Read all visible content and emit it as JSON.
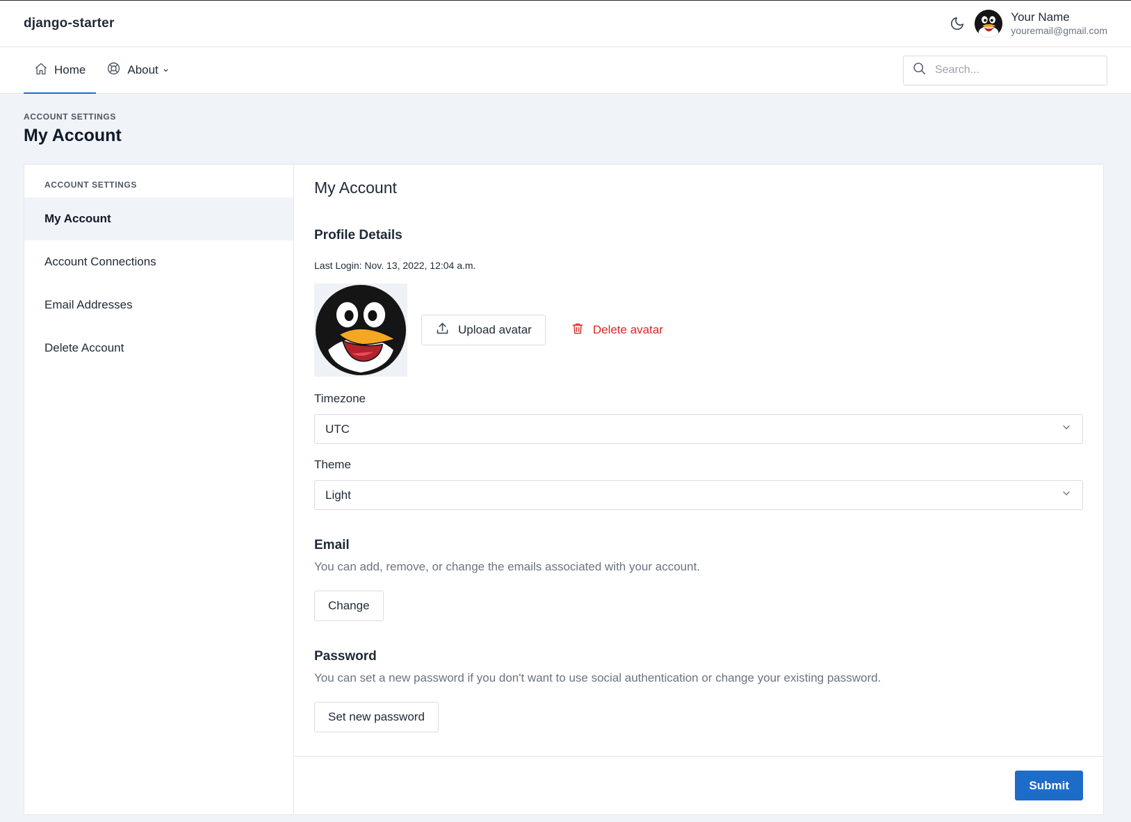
{
  "app": {
    "brand": "django-starter"
  },
  "user": {
    "name": "Your Name",
    "email": "youremail@gmail.com"
  },
  "icons": {
    "theme_toggle": "moon-icon",
    "home": "home-icon",
    "about": "lifebuoy-icon",
    "search": "search-icon",
    "upload": "upload-icon",
    "delete": "trash-icon",
    "dropdown": "chevron-down-icon"
  },
  "nav": {
    "home_label": "Home",
    "about_label": "About",
    "about_caret": "⌄",
    "active": "Home"
  },
  "search": {
    "placeholder": "Search..."
  },
  "page": {
    "eyebrow": "ACCOUNT SETTINGS",
    "title": "My Account"
  },
  "sidebar": {
    "heading": "ACCOUNT SETTINGS",
    "items": [
      {
        "label": "My Account",
        "active": true
      },
      {
        "label": "Account Connections",
        "active": false
      },
      {
        "label": "Email Addresses",
        "active": false
      },
      {
        "label": "Delete Account",
        "active": false
      }
    ]
  },
  "main": {
    "title": "My Account",
    "profile_heading": "Profile Details",
    "last_login": "Last Login: Nov. 13, 2022, 12:04 a.m.",
    "upload_label": "Upload avatar",
    "delete_label": "Delete avatar",
    "timezone_label": "Timezone",
    "timezone_value": "UTC",
    "theme_label": "Theme",
    "theme_value": "Light",
    "email_heading": "Email",
    "email_help": "You can add, remove, or change the emails associated with your account.",
    "email_button": "Change",
    "password_heading": "Password",
    "password_help": "You can set a new password if you don't want to use social authentication or change your existing password.",
    "password_button": "Set new password",
    "submit_label": "Submit"
  },
  "colors": {
    "accent": "#1d6cc8",
    "danger": "#dc2626",
    "page_bg": "#f0f3f7"
  }
}
